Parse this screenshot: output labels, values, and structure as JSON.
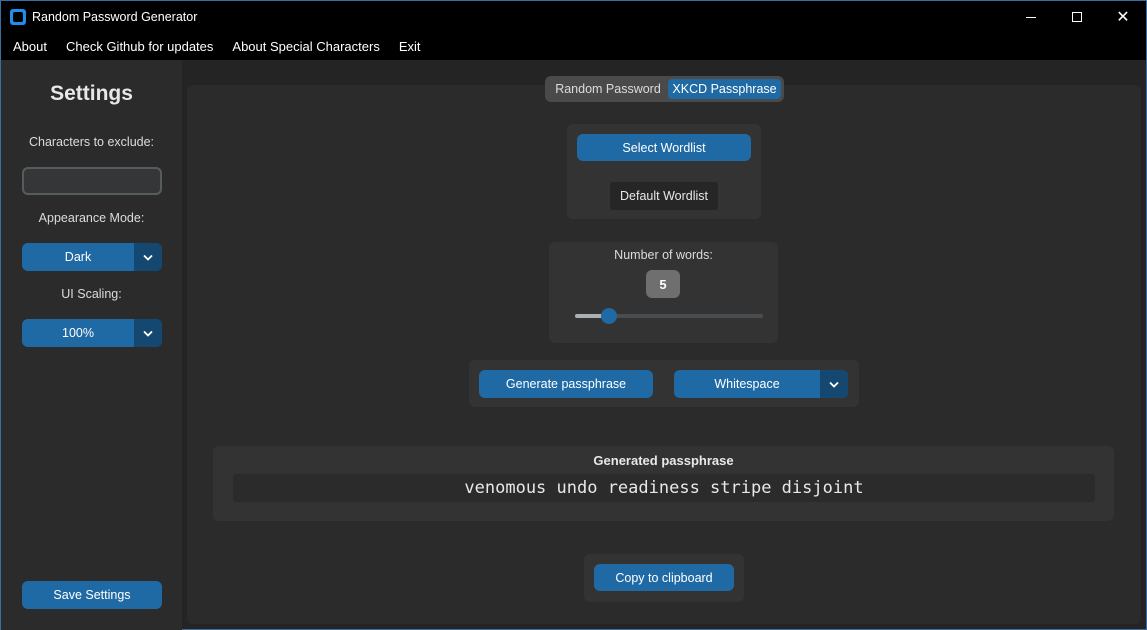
{
  "window": {
    "title": "Random Password Generator"
  },
  "menubar": {
    "items": [
      "About",
      "Check Github for updates",
      "About Special Characters",
      "Exit"
    ]
  },
  "sidebar": {
    "title": "Settings",
    "exclude_label": "Characters to exclude:",
    "exclude_value": "",
    "appearance_label": "Appearance Mode:",
    "appearance_value": "Dark",
    "scaling_label": "UI Scaling:",
    "scaling_value": "100%",
    "save_label": "Save Settings"
  },
  "tabs": {
    "items": [
      "Random Password",
      "XKCD Passphrase"
    ],
    "active": "XKCD Passphrase"
  },
  "wordlist": {
    "select_label": "Select Wordlist",
    "current_label": "Default Wordlist"
  },
  "words": {
    "label": "Number of words:",
    "value": "5",
    "slider_fraction": 0.18
  },
  "generate": {
    "button_label": "Generate passphrase",
    "separator_value": "Whitespace"
  },
  "result": {
    "title": "Generated passphrase",
    "passphrase": "venomous undo readiness stripe disjoint"
  },
  "copy_label": "Copy to clipboard",
  "icons": {
    "app": "app-icon",
    "dropdown": "chevron-down-icon",
    "minimize": "minimize-icon",
    "maximize": "maximize-icon",
    "close": "close-icon"
  },
  "colors": {
    "accent": "#1f6aa5",
    "accent_dark": "#144870",
    "titlebar": "#000000",
    "panel": "#2b2b2b",
    "background": "#242424"
  }
}
